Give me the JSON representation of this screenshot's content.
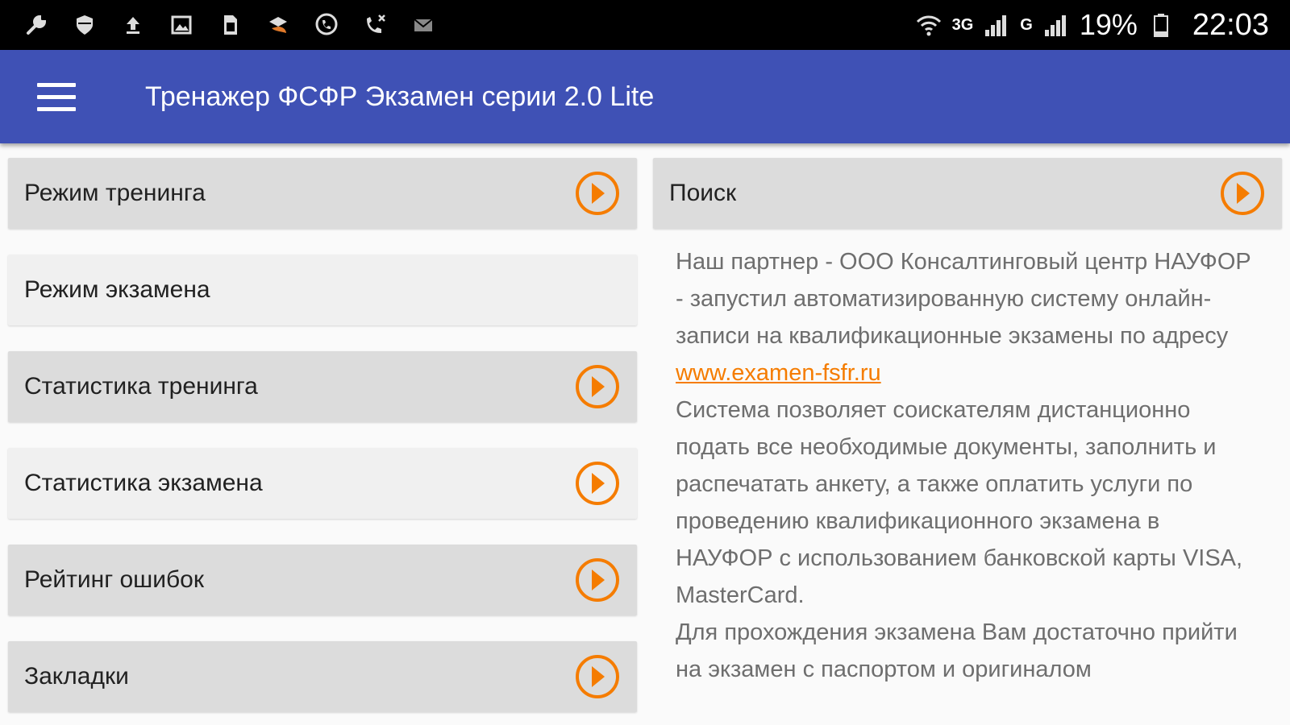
{
  "status_bar": {
    "left_icons": [
      "wrench-icon",
      "shield-icon",
      "upload-icon",
      "image-icon",
      "sim-card-icon",
      "security-app-icon",
      "viber-icon",
      "missed-call-icon",
      "mail-icon"
    ],
    "signal_label_1": "3G",
    "signal_label_2": "G",
    "battery_percent": "19%",
    "time": "22:03"
  },
  "app_bar": {
    "title": "Тренажер ФСФР Экзамен серии 2.0 Lite"
  },
  "menu": {
    "items": [
      {
        "label": "Режим тренинга",
        "has_arrow": true
      },
      {
        "label": "Режим экзамена",
        "has_arrow": false
      },
      {
        "label": "Статистика тренинга",
        "has_arrow": true
      },
      {
        "label": "Статистика экзамена",
        "has_arrow": true
      },
      {
        "label": "Рейтинг ошибок",
        "has_arrow": true
      },
      {
        "label": "Закладки",
        "has_arrow": true
      }
    ]
  },
  "search": {
    "label": "Поиск"
  },
  "info": {
    "paragraph_1": "Наш партнер - ООО Консалтинговый центр НАУФОР - запустил автоматизированную систему онлайн-записи на квалификационные экзамены по адресу",
    "link": "www.examen-fsfr.ru",
    "paragraph_2": "Система позволяет соискателям дистанционно подать все необходимые документы, заполнить и распечатать анкету, а также оплатить услуги по проведению квалификационного экзамена в НАУФОР с использованием банковской карты VISA, MasterCard.",
    "paragraph_3": "Для прохождения экзамена Вам достаточно прийти на экзамен с паспортом и оригиналом"
  },
  "colors": {
    "app_bar": "#3f51b5",
    "accent": "#f57c00",
    "item_dark": "#dcdcdc",
    "item_light": "#f0f0f0"
  }
}
